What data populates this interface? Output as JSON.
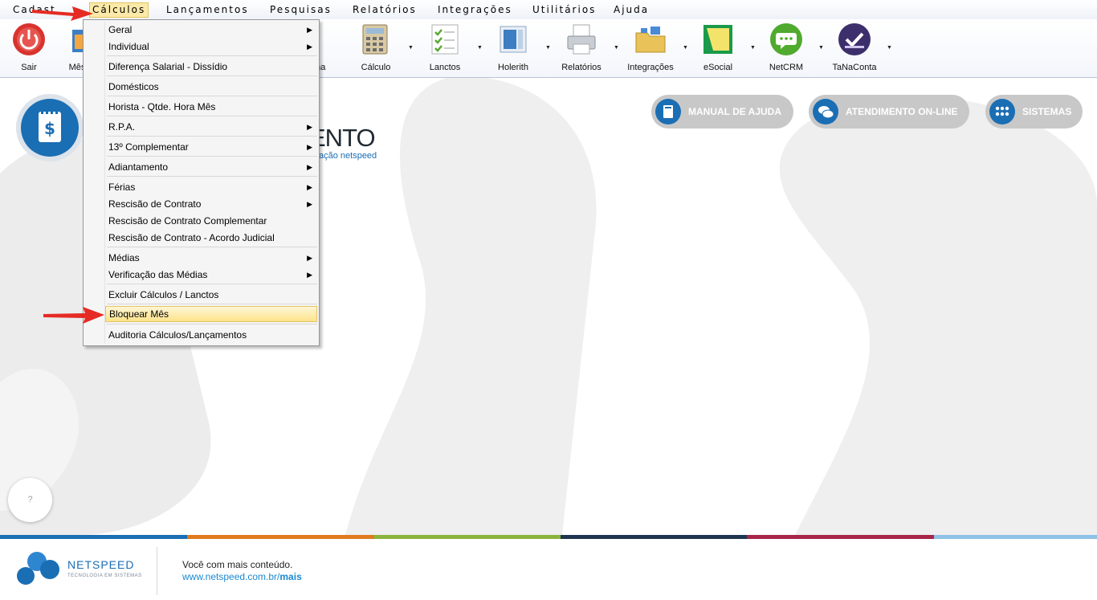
{
  "menubar": {
    "items": [
      {
        "label": "Cadastros",
        "accel": "C"
      },
      {
        "label": "Cálculos",
        "accel": "u"
      },
      {
        "label": "Lançamentos",
        "accel": "L"
      },
      {
        "label": "Pesquisas",
        "accel": "P"
      },
      {
        "label": "Relatórios",
        "accel": "R"
      },
      {
        "label": "Integrações",
        "accel": "I"
      },
      {
        "label": "Utilitários",
        "accel": "U"
      },
      {
        "label": "Ajuda",
        "accel": "d"
      }
    ],
    "visible_first": "Cadast",
    "active_index": 1
  },
  "toolbar": {
    "items": [
      {
        "label": "Sair",
        "icon": "power-icon"
      },
      {
        "label": "Mês",
        "icon": "calendar-icon"
      },
      {
        "label": "lha",
        "icon": "folha-icon"
      },
      {
        "label": "Cálculo",
        "icon": "calculator-icon"
      },
      {
        "label": "Lanctos",
        "icon": "checklist-icon"
      },
      {
        "label": "Holerith",
        "icon": "holerith-icon"
      },
      {
        "label": "Relatórios",
        "icon": "printer-icon"
      },
      {
        "label": "Integrações",
        "icon": "integration-icon"
      },
      {
        "label": "eSocial",
        "icon": "esocial-icon"
      },
      {
        "label": "NetCRM",
        "icon": "chat-icon"
      },
      {
        "label": "TaNaConta",
        "icon": "tanaconta-icon"
      }
    ]
  },
  "hero": {
    "title": "ENTO",
    "subtitle": "ação netspeed"
  },
  "pills": [
    {
      "label": "MANUAL DE AJUDA",
      "icon": "book-icon"
    },
    {
      "label": "ATENDIMENTO ON-LINE",
      "icon": "chat-bubbles-icon"
    },
    {
      "label": "SISTEMAS",
      "icon": "grid-icon"
    }
  ],
  "help": {
    "label": "?"
  },
  "footer": {
    "brand": "NETSPEED",
    "tagline": "TECNOLOGIA EM SISTEMAS",
    "line1": "Você com mais conteúdo.",
    "line2_prefix": "www.netspeed.com.br/",
    "line2_bold": "mais"
  },
  "stripe_colors": [
    "#1a6eb4",
    "#e07a1f",
    "#8bb43c",
    "#1f3550",
    "#a8264a",
    "#8ec1e6"
  ],
  "dropdown": {
    "items": [
      {
        "label": "Geral",
        "submenu": true
      },
      {
        "label": "Individual",
        "submenu": true
      },
      {
        "sep": true
      },
      {
        "label": "Diferença Salarial - Dissídio",
        "submenu": false
      },
      {
        "sep": true
      },
      {
        "label": "Domésticos",
        "submenu": false
      },
      {
        "sep": true
      },
      {
        "label": "Horista - Qtde. Hora Mês",
        "submenu": false
      },
      {
        "sep": true
      },
      {
        "label": "R.P.A.",
        "submenu": true
      },
      {
        "sep": true
      },
      {
        "label": "13º Complementar",
        "submenu": true
      },
      {
        "sep": true
      },
      {
        "label": "Adiantamento",
        "submenu": true
      },
      {
        "sep": true
      },
      {
        "label": "Férias",
        "submenu": true
      },
      {
        "label": "Rescisão de Contrato",
        "submenu": true
      },
      {
        "label": "Rescisão de Contrato Complementar",
        "submenu": false
      },
      {
        "label": "Rescisão de Contrato - Acordo Judicial",
        "submenu": false
      },
      {
        "sep": true
      },
      {
        "label": "Médias",
        "submenu": true
      },
      {
        "label": "Verificação das Médias",
        "submenu": true
      },
      {
        "sep": true
      },
      {
        "label": "Excluir Cálculos / Lanctos",
        "submenu": false
      },
      {
        "sep": true
      },
      {
        "label": "Bloquear Mês",
        "submenu": false,
        "highlighted": true
      },
      {
        "sep": true
      },
      {
        "label": "Auditoria Cálculos/Lançamentos",
        "submenu": false
      }
    ]
  }
}
